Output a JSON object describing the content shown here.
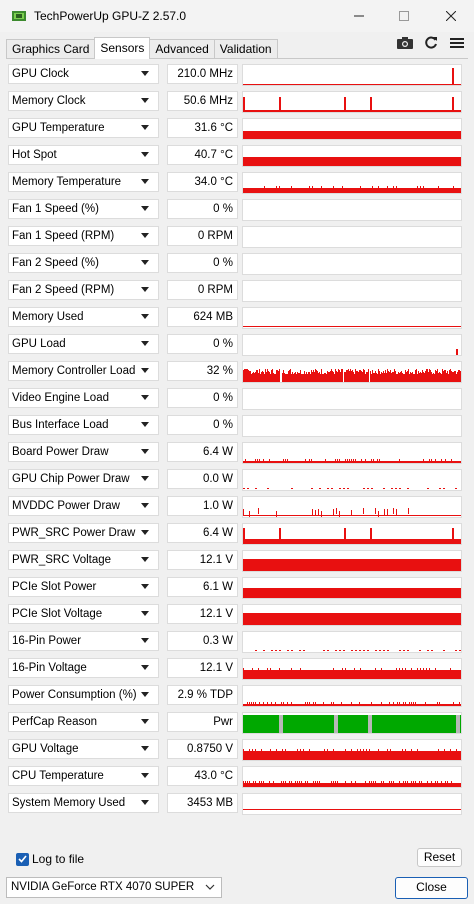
{
  "window": {
    "title": "TechPowerUp GPU-Z 2.57.0"
  },
  "tabs": [
    "Graphics Card",
    "Sensors",
    "Advanced",
    "Validation"
  ],
  "toolbar": {
    "icons": [
      "camera-icon",
      "refresh-icon",
      "menu-icon"
    ]
  },
  "sensors": [
    {
      "name": "GPU Clock",
      "value": "210.0 MHz",
      "graph": "spike-end"
    },
    {
      "name": "Memory Clock",
      "value": "50.6 MHz",
      "graph": "spikes"
    },
    {
      "name": "GPU Temperature",
      "value": "31.6 °C",
      "graph": "flat-mid"
    },
    {
      "name": "Hot Spot",
      "value": "40.7 °C",
      "graph": "flat-high"
    },
    {
      "name": "Memory Temperature",
      "value": "34.0 °C",
      "graph": "flat-mid-noise"
    },
    {
      "name": "Fan 1 Speed (%)",
      "value": "0 %",
      "graph": "none"
    },
    {
      "name": "Fan 1 Speed (RPM)",
      "value": "0 RPM",
      "graph": "none"
    },
    {
      "name": "Fan 2 Speed (%)",
      "value": "0 %",
      "graph": "none"
    },
    {
      "name": "Fan 2 Speed (RPM)",
      "value": "0 RPM",
      "graph": "none"
    },
    {
      "name": "Memory Used",
      "value": "624 MB",
      "graph": "line-low"
    },
    {
      "name": "GPU Load",
      "value": "0 %",
      "graph": "tick-end"
    },
    {
      "name": "Memory Controller Load",
      "value": "32 %",
      "graph": "dense"
    },
    {
      "name": "Video Engine Load",
      "value": "0 %",
      "graph": "none"
    },
    {
      "name": "Bus Interface Load",
      "value": "0 %",
      "graph": "none"
    },
    {
      "name": "Board Power Draw",
      "value": "6.4 W",
      "graph": "base-noise"
    },
    {
      "name": "GPU Chip Power Draw",
      "value": "0.0 W",
      "graph": "base-faint"
    },
    {
      "name": "MVDDC Power Draw",
      "value": "1.0 W",
      "graph": "base-spiky"
    },
    {
      "name": "PWR_SRC Power Draw",
      "value": "6.4 W",
      "graph": "base-spikes"
    },
    {
      "name": "PWR_SRC Voltage",
      "value": "12.1 V",
      "graph": "block"
    },
    {
      "name": "PCIe Slot Power",
      "value": "6.1 W",
      "graph": "block-mid"
    },
    {
      "name": "PCIe Slot Voltage",
      "value": "12.1 V",
      "graph": "block"
    },
    {
      "name": "16-Pin Power",
      "value": "0.3 W",
      "graph": "base-faint"
    },
    {
      "name": "16-Pin Voltage",
      "value": "12.1 V",
      "graph": "block-noise"
    },
    {
      "name": "Power Consumption (%)",
      "value": "2.9 % TDP",
      "graph": "base-noise"
    },
    {
      "name": "PerfCap Reason",
      "value": "Pwr",
      "graph": "perfcap"
    },
    {
      "name": "GPU Voltage",
      "value": "0.8750 V",
      "graph": "block-noise"
    },
    {
      "name": "CPU Temperature",
      "value": "43.0 °C",
      "graph": "base-noise-mid"
    },
    {
      "name": "System Memory Used",
      "value": "3453 MB",
      "graph": "line-mid"
    }
  ],
  "log": {
    "label": "Log to file",
    "checked": true
  },
  "buttons": {
    "reset": "Reset",
    "close": "Close"
  },
  "gpu_select": {
    "value": "NVIDIA GeForce RTX 4070 SUPER"
  },
  "colors": {
    "graph": "#e81010",
    "perfcap_green": "#00a800",
    "perfcap_gray": "#b8b8b8",
    "accent": "#1a5fb4"
  }
}
